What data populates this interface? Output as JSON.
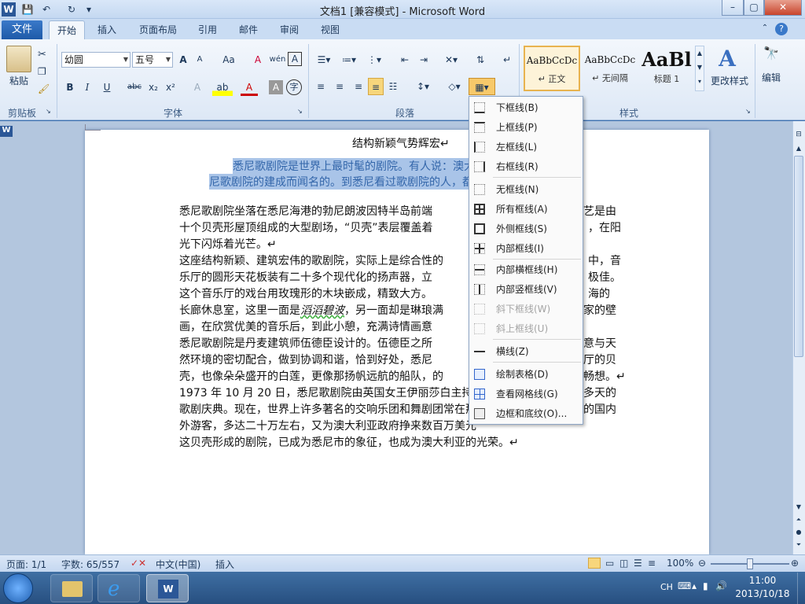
{
  "window": {
    "title": "文档1 [兼容模式] - Microsoft Word",
    "min": "–",
    "max": "▢",
    "close": "✕"
  },
  "qat": {
    "word_icon": "W",
    "save": "💾",
    "undo": "↶",
    "redo": "↻",
    "more": "▾"
  },
  "tabs": {
    "file": "文件",
    "items": [
      "开始",
      "插入",
      "页面布局",
      "引用",
      "邮件",
      "审阅",
      "视图"
    ],
    "help": "?"
  },
  "clipboard": {
    "paste": "粘贴",
    "label": "剪贴板"
  },
  "font": {
    "name": "幼圆",
    "size": "五号",
    "label": "字体",
    "grow": "A",
    "shrink": "A",
    "case": "Aa",
    "clear": "A",
    "phonetic": "wén",
    "border_char": "A",
    "bold": "B",
    "italic": "I",
    "underline": "U",
    "strike": "abc",
    "sub": "x₂",
    "sup": "x²",
    "effects": "A",
    "highlight": "ab",
    "color": "A",
    "shade": "A",
    "enclose": "字"
  },
  "paragraph": {
    "label": "段落"
  },
  "styles": {
    "label": "样式",
    "items": [
      {
        "sample": "AaBbCcDc",
        "name": "↵ 正文"
      },
      {
        "sample": "AaBbCcDc",
        "name": "↵ 无间隔"
      },
      {
        "sample": "AaBl",
        "name": "标题 1"
      }
    ],
    "change": "更改样式",
    "edit": "编辑",
    "change_icon": "A",
    "edit_icon": "🔭"
  },
  "border_menu": [
    {
      "label": "下框线(B)",
      "enabled": true
    },
    {
      "label": "上框线(P)",
      "enabled": true
    },
    {
      "label": "左框线(L)",
      "enabled": true
    },
    {
      "label": "右框线(R)",
      "enabled": true
    },
    {
      "label": "无框线(N)",
      "enabled": true
    },
    {
      "label": "所有框线(A)",
      "enabled": true
    },
    {
      "label": "外侧框线(S)",
      "enabled": true
    },
    {
      "label": "内部框线(I)",
      "enabled": true
    },
    {
      "label": "内部横框线(H)",
      "enabled": true
    },
    {
      "label": "内部竖框线(V)",
      "enabled": true
    },
    {
      "label": "斜下框线(W)",
      "enabled": false
    },
    {
      "label": "斜上框线(U)",
      "enabled": false
    },
    {
      "label": "横线(Z)",
      "enabled": true
    },
    {
      "label": "绘制表格(D)",
      "enabled": true
    },
    {
      "label": "查看网格线(G)",
      "enabled": true
    },
    {
      "label": "边框和底纹(O)...",
      "enabled": true
    }
  ],
  "document": {
    "title": "结构新颖气势辉宏↵",
    "highlight_lines": [
      "悉尼歌剧院是世界上最时髦的剧院。有人说：澳大",
      "尼歌剧院的建成而闻名的。到悉尼看过歌剧院的人，都"
    ],
    "lines": [
      "悉尼歌剧院坐落在悉尼海港的勃尼朗波因特半岛前端",
      "十个贝壳形屋顶组成的大型剧场，“贝壳”表层覆盖着",
      "光下闪烁着光芒。↵",
      "这座结构新颖、建筑宏伟的歌剧院，实际上是综合性的",
      "乐厅的圆形天花板装有二十多个现代化的扬声器，立",
      "这个音乐厅的戏台用玫瑰形的木块嵌成，精致大方。",
      "长廊休息室，这里一面是",
      "画，在欣赏优美的音乐后，到此小憩，充满诗情画意",
      "悉尼歌剧院是丹麦建筑师伍德臣设计的。伍德臣之所",
      "然环境的密切配合，做到协调和谐，恰到好处，悉尼",
      "壳，也像朵朵盛开的白莲，更像那扬帆远航的船队，的",
      "1973 年 10 月 20 日，悉尼歌剧院由英国女王伊丽莎白主持揭",
      "歌剧庆典。现在，世界上许多著名的交响乐团和舞剧团常在那",
      "外游客，多达二十万左右，又为澳大利亚政府挣来数百万美元",
      "这贝壳形成的剧院，已成为悉尼市的象征，也成为澳大利亚的光荣。↵"
    ],
    "italic_phrase": "滔滔碧波",
    "line7_rest": "，另一面却是琳琅满",
    "right_fragments": [
      "艺是由",
      "，在阳",
      "中，音",
      "极佳。",
      "海的",
      "家的壁",
      "意与天",
      "厅的贝",
      "畅想。↵",
      "多天的",
      "的国内"
    ]
  },
  "status": {
    "page": "页面: 1/1",
    "words": "字数: 65/557",
    "lang": "中文(中国)",
    "mode": "插入",
    "zoom": "100%"
  },
  "tray": {
    "ime": "CH",
    "time": "11:00",
    "date": "2013/10/18"
  }
}
